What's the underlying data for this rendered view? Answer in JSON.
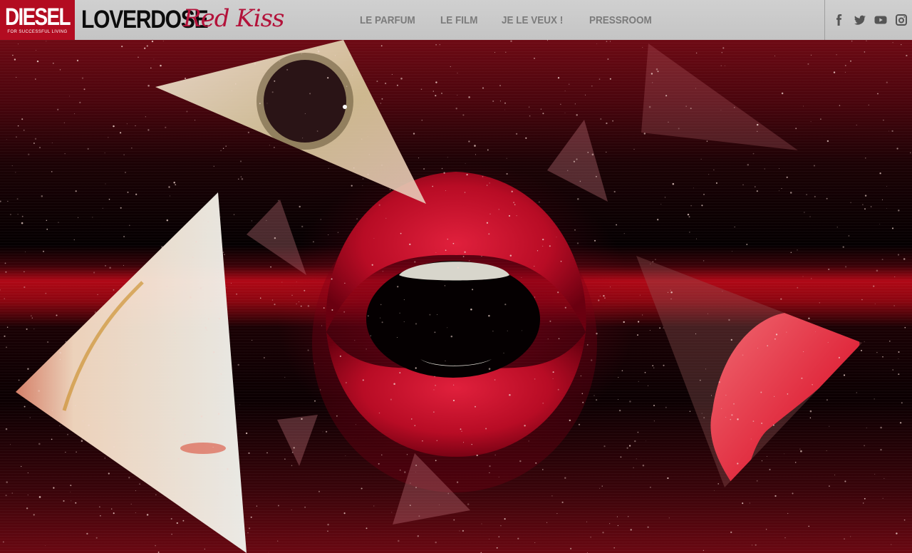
{
  "brand": {
    "logo_word": "DIESEL",
    "logo_tagline": "FOR SUCCESSFUL LIVING",
    "product": "LOVERDOSE",
    "product_script": "Red Kiss"
  },
  "nav": {
    "items": [
      {
        "label": "LE PARFUM"
      },
      {
        "label": "LE FILM"
      },
      {
        "label": "JE LE VEUX !"
      },
      {
        "label": "PRESSROOM"
      }
    ]
  },
  "social": {
    "icons": [
      "facebook-icon",
      "twitter-icon",
      "youtube-icon",
      "instagram-icon"
    ]
  },
  "colors": {
    "header_bg": "#c8c8c8",
    "logo_red": "#b30c21",
    "script_red": "#b3123a",
    "nav_text": "#7b7b7b",
    "hero_red": "#b00816"
  }
}
